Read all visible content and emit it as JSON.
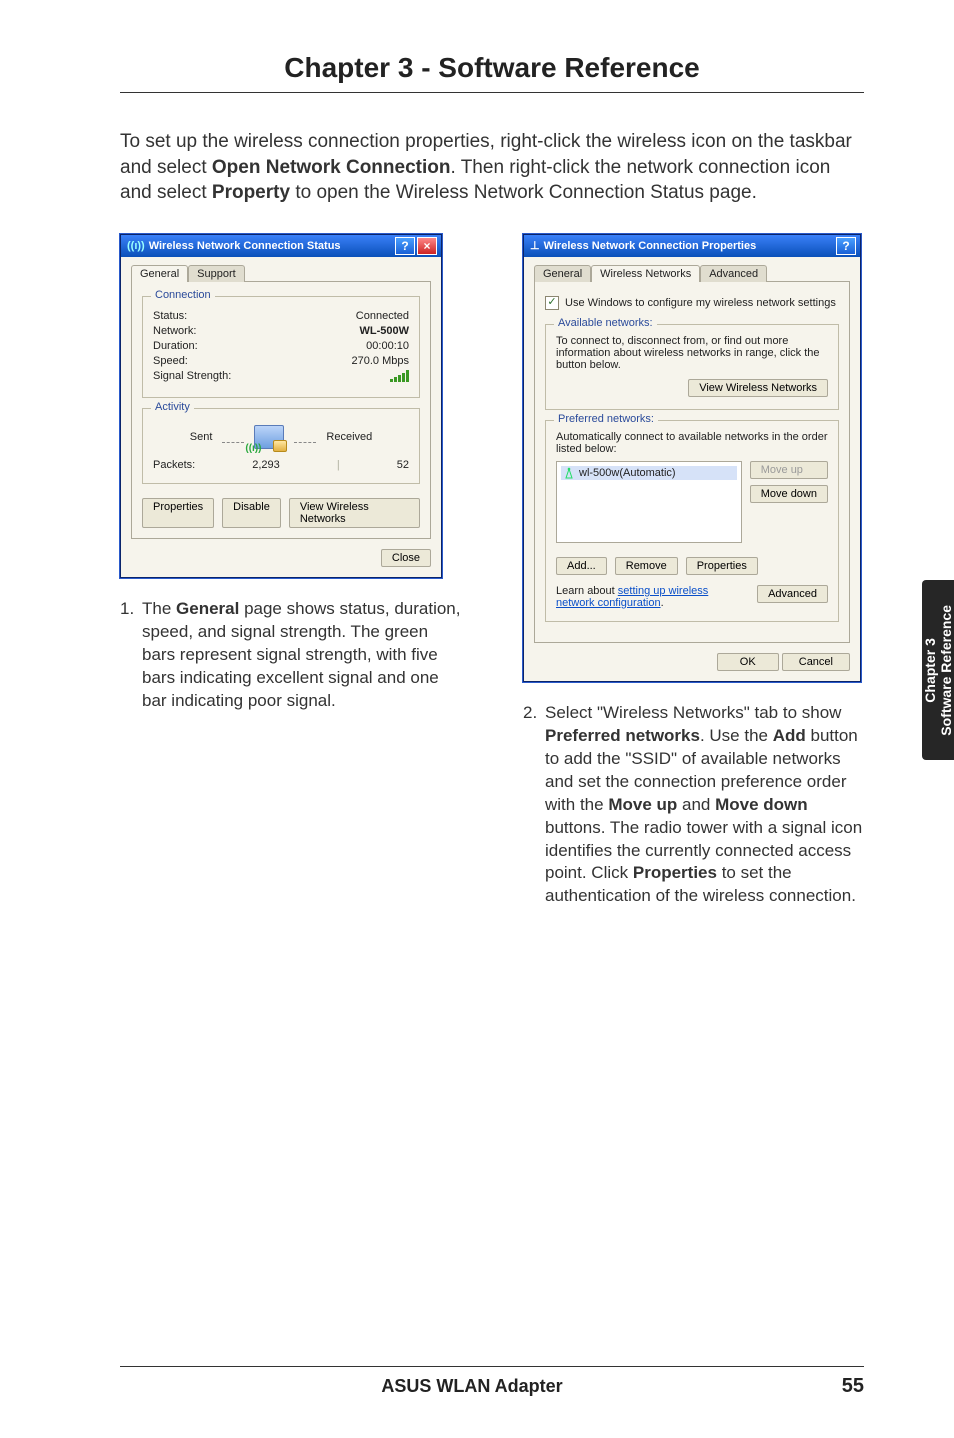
{
  "doc": {
    "chapter_title": "Chapter 3 - Software Reference",
    "intro_parts": {
      "p1": "To set up the wireless connection properties, right-click the wireless icon on the taskbar and select ",
      "b1": "Open Network Connection",
      "p2": ". Then right-click the network connection icon and select ",
      "b2": "Property",
      "p3": " to open the Wireless Network Connection Status page."
    },
    "footer": {
      "product": "ASUS WLAN Adapter",
      "page": "55"
    },
    "sidetab": {
      "line1": "Chapter 3",
      "line2": "Software Reference"
    }
  },
  "caption1": {
    "num": "1.",
    "parts": {
      "a": " The ",
      "b": "General",
      "c": " page shows status, duration, speed, and signal strength. The green bars represent signal strength, with five bars indicating excellent signal and one bar indicating poor signal."
    }
  },
  "caption2": {
    "num": "2.",
    "parts": {
      "a": " Select \"Wireless Networks\" tab to show ",
      "b1": "Preferred networks",
      "a2": ". Use the ",
      "b2": "Add",
      "a3": " button to add the \"SSID\" of available networks and set the connection preference order with the ",
      "b3": "Move up",
      "a4": " and ",
      "b4": "Move down",
      "a5": " buttons. The radio tower with a signal icon identifies the currently connected access point. Click ",
      "b5": "Properties",
      "a6": " to set the authentication of the wireless connection."
    }
  },
  "dlg1": {
    "title": "Wireless Network Connection Status",
    "help": "?",
    "close": "×",
    "tabs": {
      "general": "General",
      "support": "Support"
    },
    "conn_legend": "Connection",
    "rows": {
      "status_l": "Status:",
      "status_v": "Connected",
      "network_l": "Network:",
      "network_v": "WL-500W",
      "duration_l": "Duration:",
      "duration_v": "00:00:10",
      "speed_l": "Speed:",
      "speed_v": "270.0 Mbps",
      "signal_l": "Signal Strength:"
    },
    "act_legend": "Activity",
    "sent": "Sent",
    "received": "Received",
    "packets_l": "Packets:",
    "packets_sent": "2,293",
    "packets_recv": "52",
    "btn_props": "Properties",
    "btn_disable": "Disable",
    "btn_view": "View Wireless Networks",
    "btn_close": "Close"
  },
  "dlg2": {
    "title": "Wireless Network Connection Properties",
    "help": "?",
    "tabs": {
      "general": "General",
      "wn": "Wireless Networks",
      "adv": "Advanced"
    },
    "use_windows": "Use Windows to configure my wireless network settings",
    "avail_legend": "Available networks:",
    "avail_text": "To connect to, disconnect from, or find out more information about wireless networks in range, click the button below.",
    "btn_view": "View Wireless Networks",
    "pref_legend": "Preferred networks:",
    "pref_text": "Automatically connect to available networks in the order listed below:",
    "net_item": "wl-500w(Automatic)",
    "btn_up": "Move up",
    "btn_down": "Move down",
    "btn_add": "Add...",
    "btn_remove": "Remove",
    "btn_props": "Properties",
    "learn1": "Learn about ",
    "learn_link": "setting up wireless network configuration",
    "learn2": ".",
    "btn_adv": "Advanced",
    "btn_ok": "OK",
    "btn_cancel": "Cancel"
  }
}
